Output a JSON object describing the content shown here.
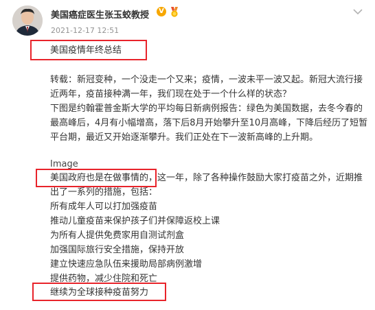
{
  "post": {
    "author_name": "美国癌症医生张玉蛟教授",
    "verified_badge": "V",
    "timestamp": "2021-12-17 12:51",
    "title": "美国疫情年终总结",
    "paragraph1": [
      "转载：新冠变种，一个没走一个又来；疫情，一波未平一波又起。新冠大流行接",
      "近两年，疫苗接种满一年，我们现在处于一个什么样的状态？"
    ],
    "paragraph2": [
      "下图是约翰霍普金斯大学的平均每日新病例报告：绿色为美国数据，去冬今春的",
      "最高峰后，4月有小幅增高，落下后8月开始攀升至10月高峰，下降后经历了短暂",
      "平台期，最近又开始逐渐攀升。我们正处在下一波新高峰的上升期。"
    ],
    "image_placeholder": "Image",
    "paragraph3": [
      "美国政府也是在做事情的，这一年，除了各种操作鼓励大家打疫苗之外，近期推",
      "出了一系列的措施，包括："
    ],
    "measures": [
      "所有成年人可以打加强疫苗",
      "推动儿童疫苗来保护孩子们并保障返校上课",
      "为所有人提供免费家用自测试剂盒",
      "加强国际旅行安全措施，保持开放",
      "建立快速应急队伍来援助局部病例激增",
      "提供药物，减少住院和死亡",
      "继续为全球接种疫苗努力"
    ]
  },
  "icons": {
    "verified": "verified-v-icon",
    "medal": "medal-icon",
    "menu": "chevron-down-icon"
  },
  "colors": {
    "highlight": "#e8232a",
    "verified": "#f7a700",
    "timestamp": "#939393",
    "text": "#333333"
  }
}
